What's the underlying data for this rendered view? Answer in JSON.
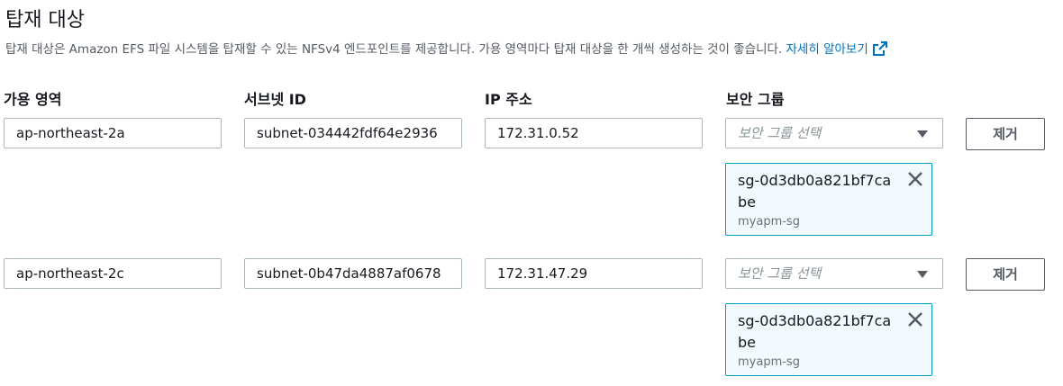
{
  "header": {
    "title": "탑재 대상",
    "description": "탑재 대상은 Amazon EFS 파일 시스템을 탑재할 수 있는 NFSv4 엔드포인트를 제공합니다. 가용 영역마다 탑재 대상을 한 개씩 생성하는 것이 좋습니다.",
    "learn_more": "자세히 알아보기",
    "link_color": "#0073bb"
  },
  "columns": {
    "az": "가용 영역",
    "subnet": "서브넷 ID",
    "ip": "IP 주소",
    "sg": "보안 그룹"
  },
  "rows": [
    {
      "az": "ap-northeast-2a",
      "subnet": "subnet-034442fdf64e2936",
      "ip": "172.31.0.52",
      "sg_placeholder": "보안 그룹 선택",
      "token_id": "sg-0d3db0a821bf7cabe",
      "token_name": "myapm-sg",
      "remove": "제거"
    },
    {
      "az": "ap-northeast-2c",
      "subnet": "subnet-0b47da4887af0678",
      "ip": "172.31.47.29",
      "sg_placeholder": "보안 그룹 선택",
      "token_id": "sg-0d3db0a821bf7cabe",
      "token_name": "myapm-sg",
      "remove": "제거"
    }
  ],
  "icons": {
    "external_link": "external-link-icon",
    "dropdown": "caret-down-icon",
    "dismiss": "close-icon"
  },
  "colors": {
    "token_border": "#00a1c9",
    "token_bg": "#f1faff"
  }
}
